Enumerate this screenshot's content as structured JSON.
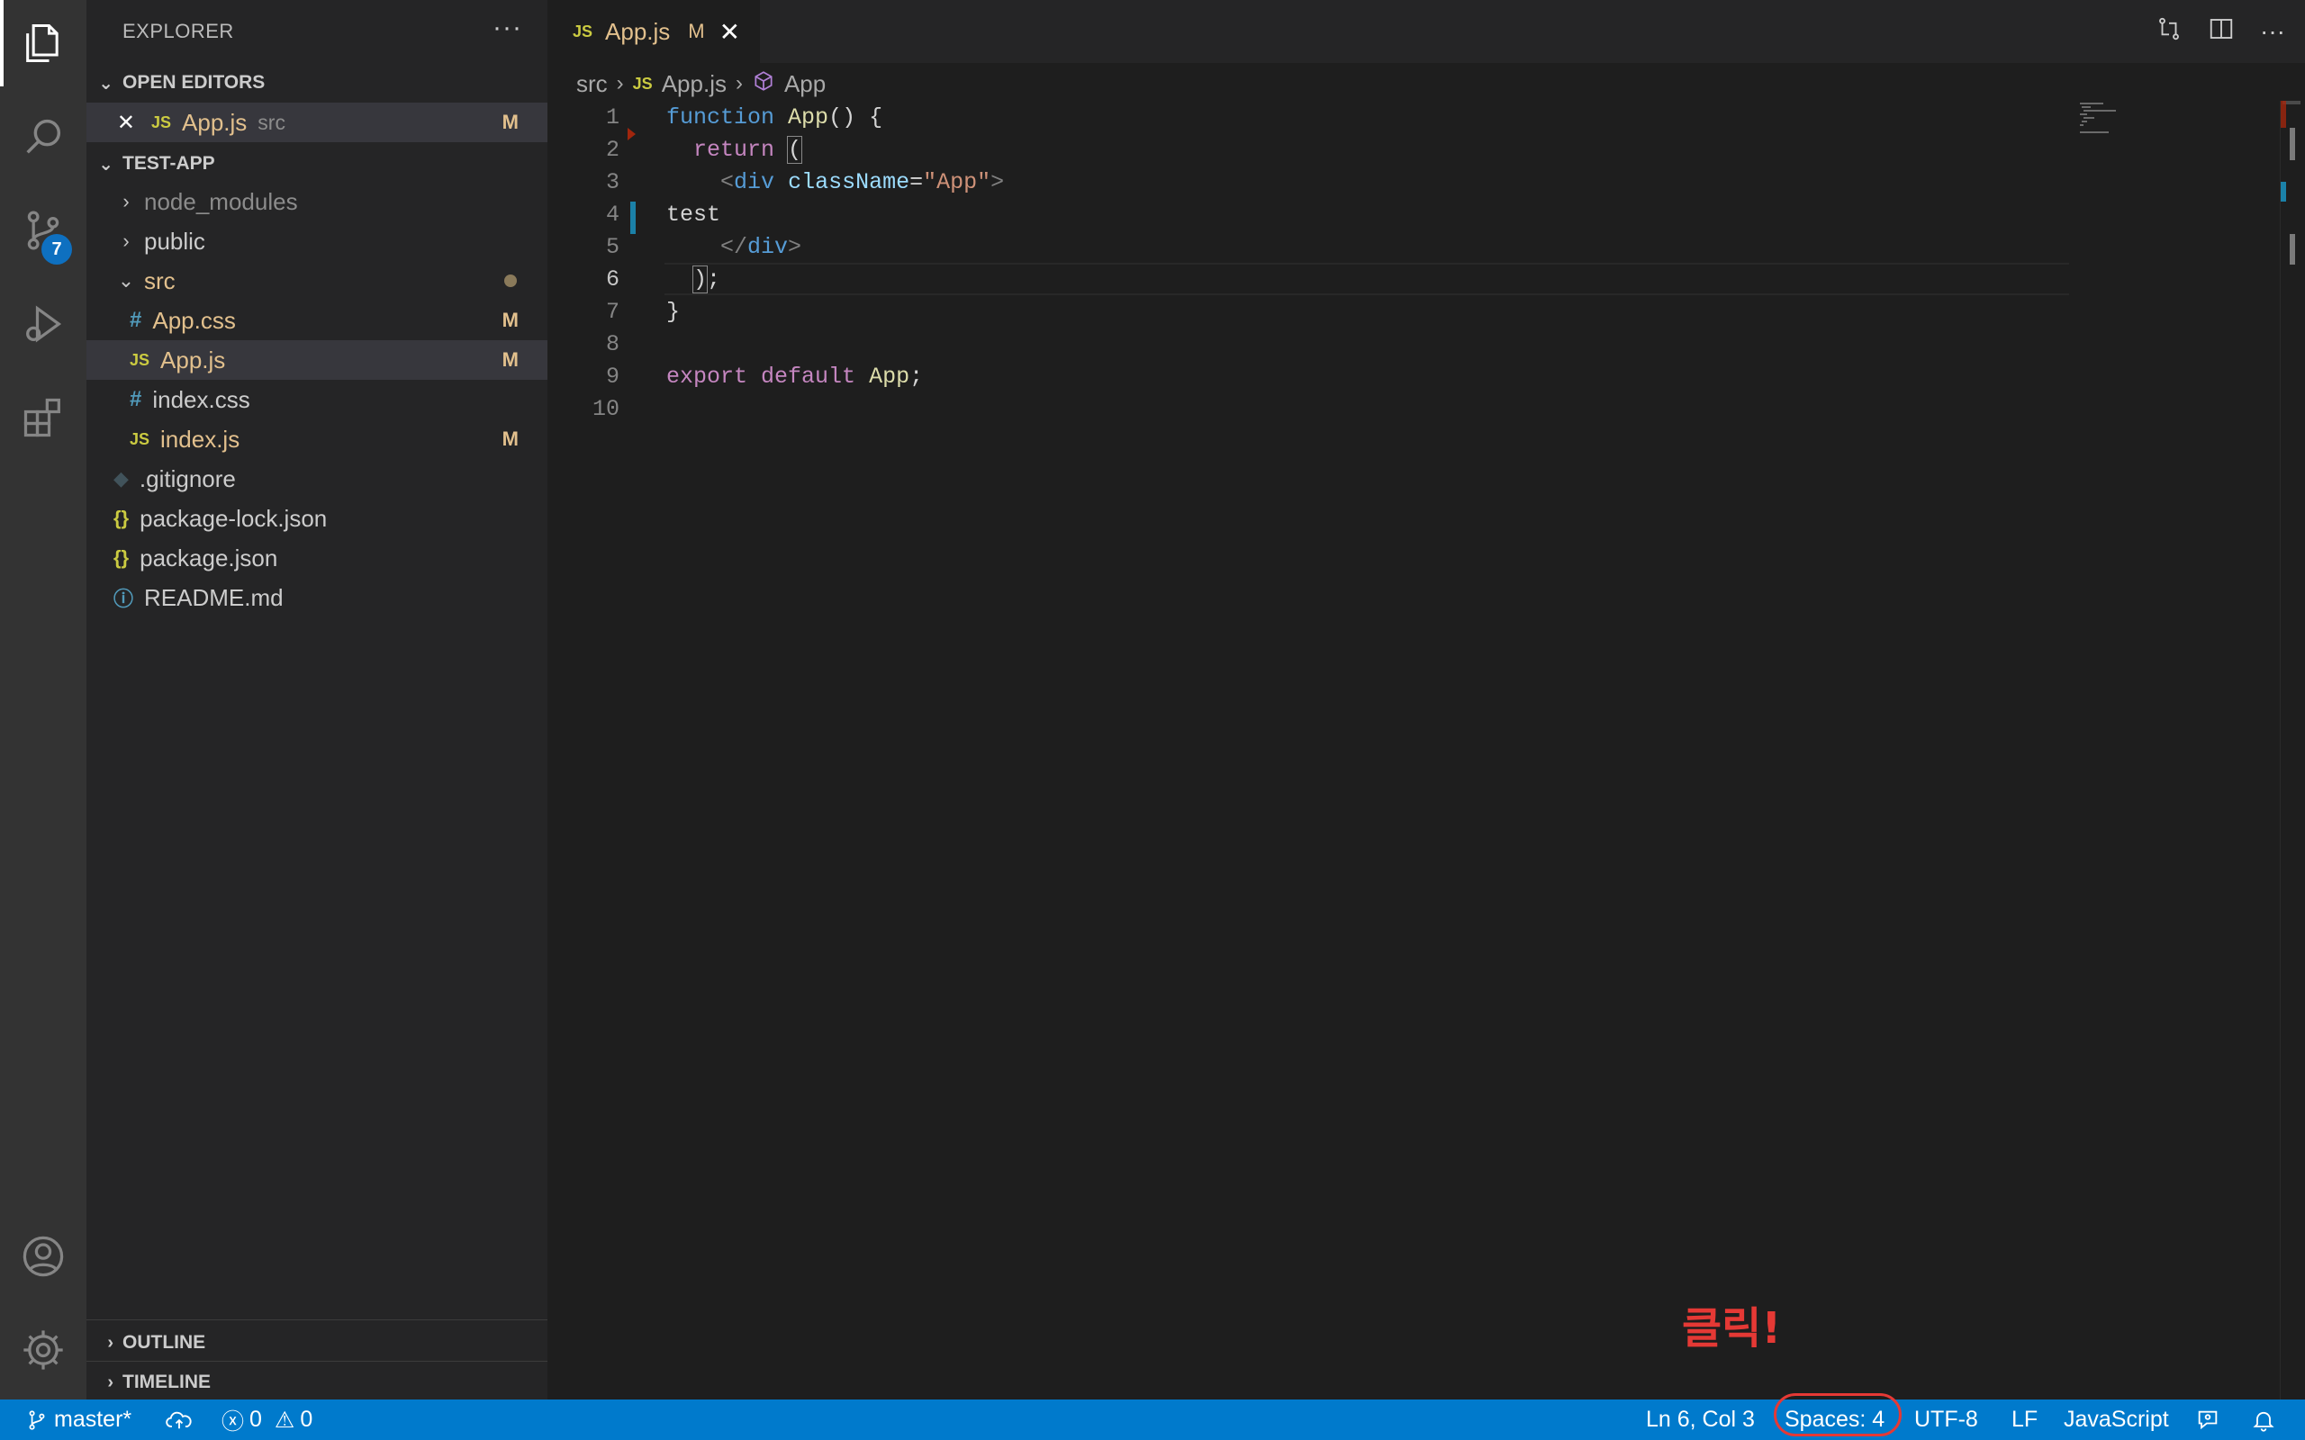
{
  "sidebar": {
    "title": "EXPLORER",
    "more": "···",
    "open_editors_header": "OPEN EDITORS",
    "open_editor": {
      "name": "App.js",
      "folder": "src",
      "status": "M",
      "close": "✕",
      "icon": "JS"
    },
    "project_header": "TEST-APP",
    "tree": [
      {
        "name": "node_modules",
        "type": "folder"
      },
      {
        "name": "public",
        "type": "folder"
      },
      {
        "name": "src",
        "type": "folder-open"
      },
      {
        "name": "App.css",
        "icon": "#",
        "status": "M"
      },
      {
        "name": "App.js",
        "icon": "JS",
        "status": "M"
      },
      {
        "name": "index.css",
        "icon": "#"
      },
      {
        "name": "index.js",
        "icon": "JS",
        "status": "M"
      },
      {
        "name": ".gitignore",
        "icon": "◆"
      },
      {
        "name": "package-lock.json",
        "icon": "{}"
      },
      {
        "name": "package.json",
        "icon": "{}"
      },
      {
        "name": "README.md",
        "icon": "ⓘ"
      }
    ],
    "outline_header": "OUTLINE",
    "timeline_header": "TIMELINE"
  },
  "activity": {
    "source_control_badge": "7"
  },
  "tab": {
    "icon": "JS",
    "name": "App.js",
    "status": "M",
    "close": "✕"
  },
  "tab_actions": [
    "compare-icon",
    "split-editor-icon",
    "more-icon"
  ],
  "breadcrumb": {
    "folder": "src",
    "file_icon": "JS",
    "file": "App.js",
    "symbol": "App"
  },
  "editor": {
    "line_numbers": [
      "1",
      "2",
      "3",
      "4",
      "5",
      "6",
      "7",
      "8",
      "9",
      "10"
    ],
    "current_line": "6"
  },
  "annotation": "클릭!",
  "status": {
    "branch": "master*",
    "errors": "0",
    "warnings": "0",
    "position": "Ln 6, Col 3",
    "indent": "Spaces: 4",
    "encoding": "UTF-8",
    "eol": "LF",
    "language": "JavaScript"
  },
  "colors": {
    "status_bar": "#007acc",
    "annotation": "#e53935",
    "modified": "#e2c08d"
  }
}
